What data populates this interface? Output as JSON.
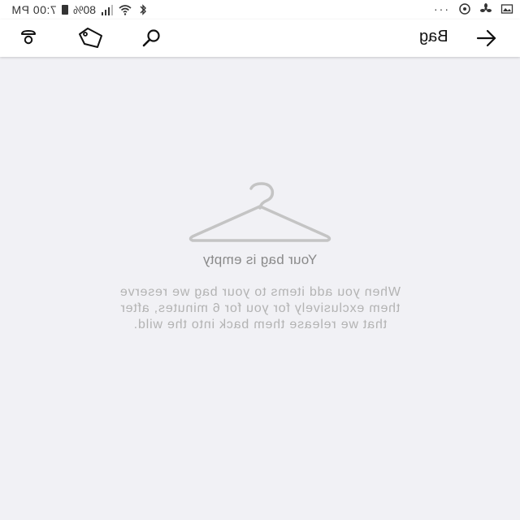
{
  "status_bar": {
    "time": "7:00 PM",
    "battery": "80%",
    "overflow": "···"
  },
  "header": {
    "title": "Bag"
  },
  "icons": {
    "profile": "profile-icon",
    "tag": "tag-icon",
    "search": "search-icon",
    "back": "back-arrow-icon",
    "hanger": "hanger-icon"
  },
  "empty_state": {
    "title": "Your bag is empty",
    "lines": [
      "When you add items to your bag we reserve",
      "them exclusively for you for 6 minutes, after",
      "that we release them back into the wild."
    ]
  },
  "colors": {
    "background": "#f1f1f5",
    "header": "#ffffff",
    "title_text": "#8a8a8a",
    "body_text": "#b3b3b3",
    "hanger": "#c4c4c4"
  }
}
